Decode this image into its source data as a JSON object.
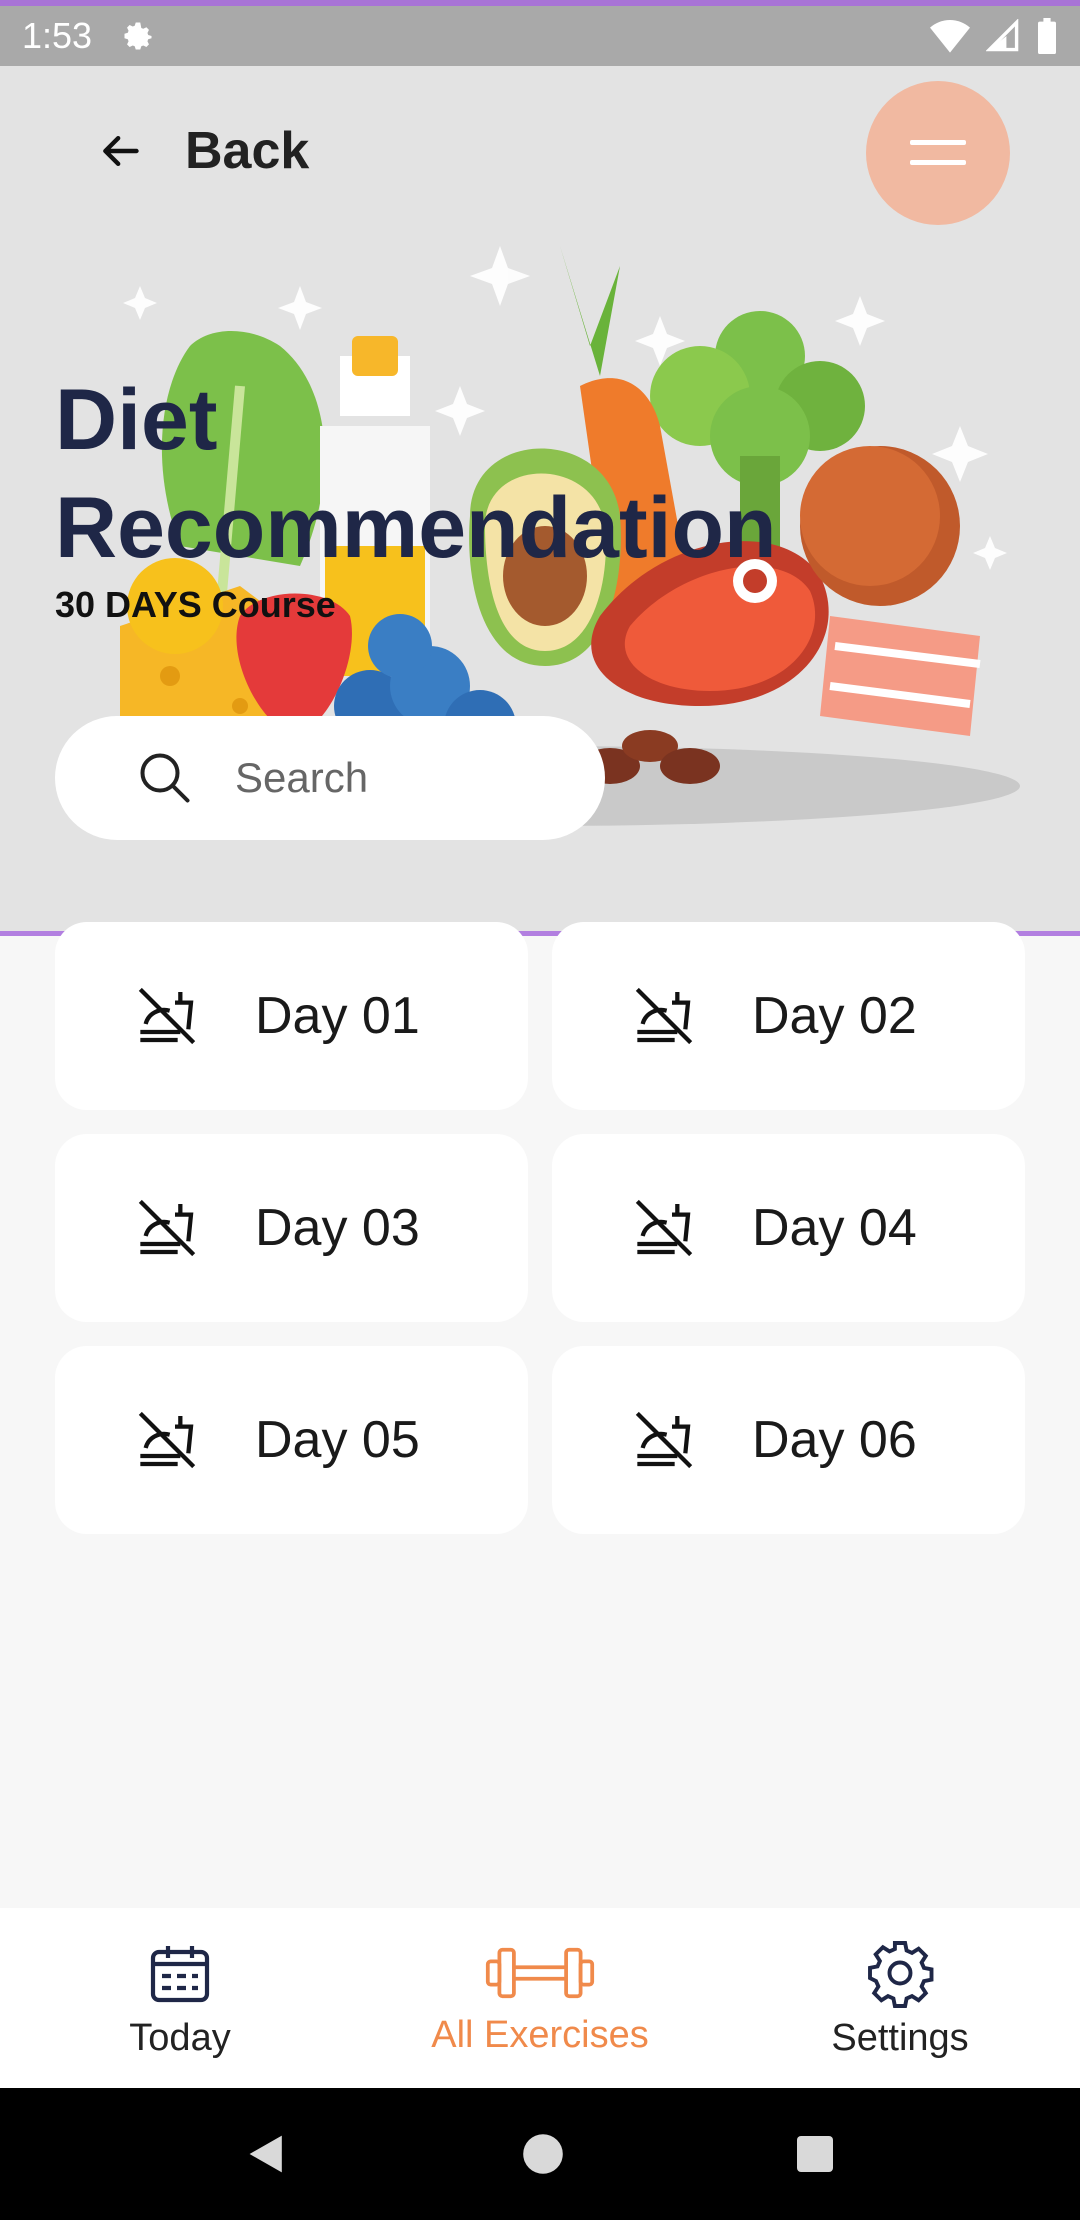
{
  "status_bar": {
    "time": "1:53"
  },
  "header": {
    "back_label": "Back",
    "title_line1": "Diet",
    "title_line2": "Recommendation",
    "subtitle": "30 DAYS Course",
    "search_placeholder": "Search"
  },
  "days": [
    {
      "label": "Day 01"
    },
    {
      "label": "Day 02"
    },
    {
      "label": "Day 03"
    },
    {
      "label": "Day 04"
    },
    {
      "label": "Day 05"
    },
    {
      "label": "Day 06"
    }
  ],
  "bottom_nav": {
    "today": "Today",
    "all_exercises": "All Exercises",
    "settings": "Settings",
    "active": "all_exercises"
  },
  "colors": {
    "accent": "#f08a4b",
    "title": "#1f2747",
    "menu_button": "#f1b9a1",
    "divider": "#b27fe0"
  },
  "icons": {
    "back": "arrow-left-icon",
    "menu": "menu-icon",
    "search": "search-icon",
    "day": "no-food-icon",
    "today": "calendar-icon",
    "exercises": "dumbbell-icon",
    "settings": "gear-icon"
  }
}
